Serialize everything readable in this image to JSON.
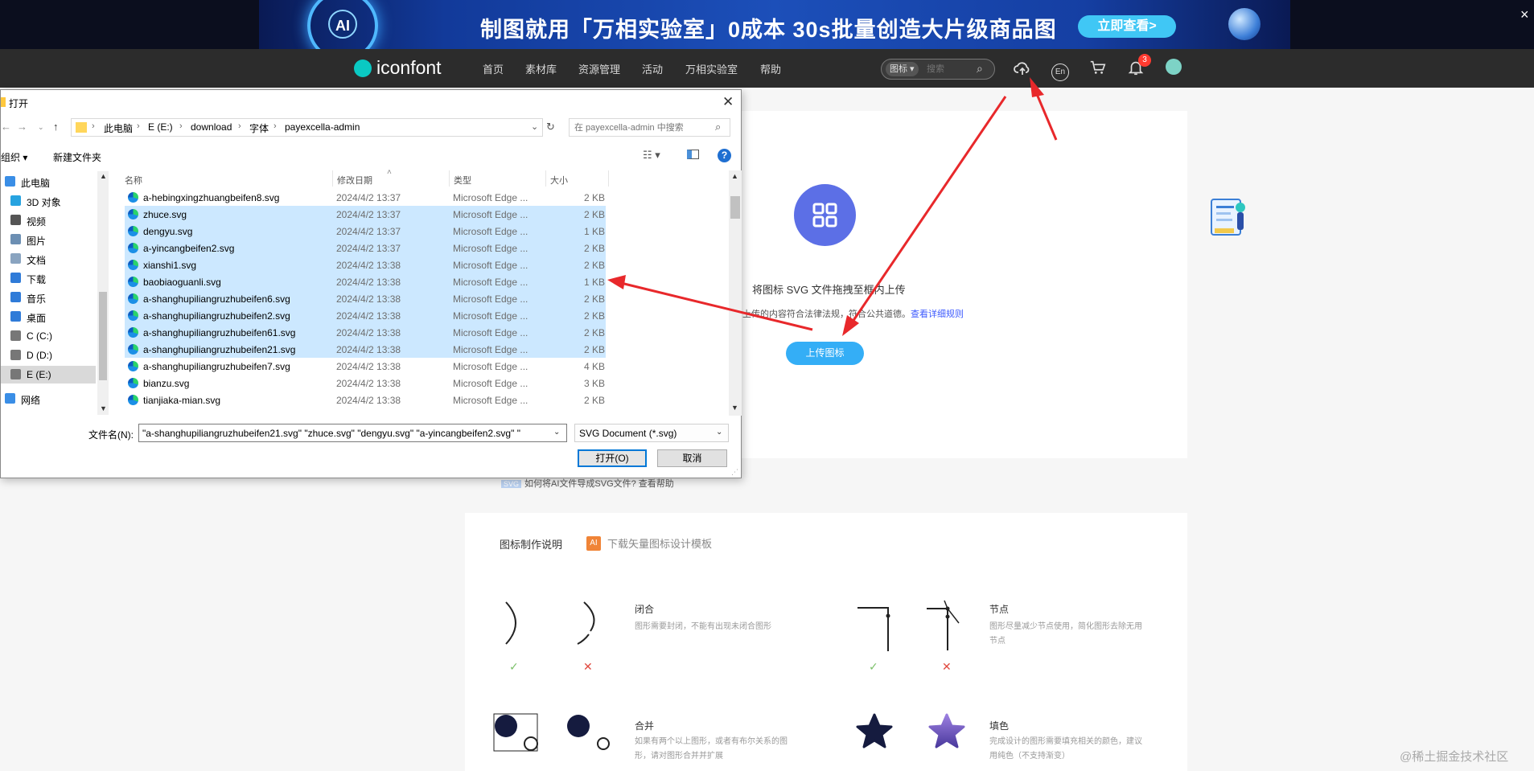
{
  "banner": {
    "ai_badge": "AI",
    "headline": "制图就用「万相实验室」0成本 30s批量创造大片级商品图",
    "cta": "立即查看>",
    "close": "×"
  },
  "nav": {
    "logo": "iconfont",
    "items": [
      "首页",
      "素材库",
      "资源管理",
      "活动",
      "万相实验室",
      "帮助"
    ],
    "search_type": "图标",
    "search_placeholder": "搜索",
    "lang_icon_text": "En",
    "notification_count": "3"
  },
  "upload": {
    "hint": "将图标 SVG 文件拖拽至框内上传",
    "legal": "上传的内容符合法律法规，符合公共道德。",
    "legal_link": "查看详细规则",
    "button": "上传图标",
    "ai_help_tag": "SVG",
    "ai_help": "如何将AI文件导成SVG文件? 查看帮助"
  },
  "guide": {
    "title": "图标制作说明",
    "template_icon": "AI",
    "template_link": "下载矢量图标设计模板",
    "rules": [
      {
        "title": "闭合",
        "desc": "图形需要封闭，不能有出现未闭合图形"
      },
      {
        "title": "节点",
        "desc": "图形尽量减少节点使用，简化图形去除无用节点"
      },
      {
        "title": "合并",
        "desc": "如果有两个以上图形，或者有布尔关系的图形，请对图形合并并扩展"
      },
      {
        "title": "填色",
        "desc": "完成设计的图形需要填充相关的颜色，建议用纯色（不支持渐变）"
      }
    ],
    "ok_mark": "✓",
    "bad_mark": "✕"
  },
  "watermark": "@稀土掘金技术社区",
  "dialog": {
    "title": "打开",
    "close": "✕",
    "path": [
      "此电脑",
      "E (E:)",
      "download",
      "字体",
      "payexcella-admin"
    ],
    "search_placeholder": "在 payexcella-admin 中搜索",
    "organize": "组织 ▾",
    "new_folder": "新建文件夹",
    "help": "?",
    "tree": [
      {
        "label": "此电脑",
        "color": "#3a8ee6"
      },
      {
        "label": "3D 对象",
        "color": "#27a3e0"
      },
      {
        "label": "视频",
        "color": "#555555"
      },
      {
        "label": "图片",
        "color": "#6c8fb3"
      },
      {
        "label": "文档",
        "color": "#8aa4c0"
      },
      {
        "label": "下载",
        "color": "#2f7bd8"
      },
      {
        "label": "音乐",
        "color": "#2f7bd8"
      },
      {
        "label": "桌面",
        "color": "#2f7bd8"
      },
      {
        "label": "C (C:)",
        "color": "#777777"
      },
      {
        "label": "D (D:)",
        "color": "#777777"
      },
      {
        "label": "E (E:)",
        "color": "#777777"
      },
      {
        "label": "网络",
        "color": "#3a8ee6"
      }
    ],
    "columns": {
      "name": "名称",
      "date": "修改日期",
      "type": "类型",
      "size": "大小"
    },
    "files": [
      {
        "name": "a-hebingxingzhuangbeifen8.svg",
        "date": "2024/4/2 13:37",
        "type": "Microsoft Edge ...",
        "size": "2 KB",
        "selected": false
      },
      {
        "name": "zhuce.svg",
        "date": "2024/4/2 13:37",
        "type": "Microsoft Edge ...",
        "size": "2 KB",
        "selected": true
      },
      {
        "name": "dengyu.svg",
        "date": "2024/4/2 13:37",
        "type": "Microsoft Edge ...",
        "size": "1 KB",
        "selected": true
      },
      {
        "name": "a-yincangbeifen2.svg",
        "date": "2024/4/2 13:37",
        "type": "Microsoft Edge ...",
        "size": "2 KB",
        "selected": true
      },
      {
        "name": "xianshi1.svg",
        "date": "2024/4/2 13:38",
        "type": "Microsoft Edge ...",
        "size": "2 KB",
        "selected": true
      },
      {
        "name": "baobiaoguanli.svg",
        "date": "2024/4/2 13:38",
        "type": "Microsoft Edge ...",
        "size": "1 KB",
        "selected": true
      },
      {
        "name": "a-shanghupiliangruzhubeifen6.svg",
        "date": "2024/4/2 13:38",
        "type": "Microsoft Edge ...",
        "size": "2 KB",
        "selected": true
      },
      {
        "name": "a-shanghupiliangruzhubeifen2.svg",
        "date": "2024/4/2 13:38",
        "type": "Microsoft Edge ...",
        "size": "2 KB",
        "selected": true
      },
      {
        "name": "a-shanghupiliangruzhubeifen61.svg",
        "date": "2024/4/2 13:38",
        "type": "Microsoft Edge ...",
        "size": "2 KB",
        "selected": true
      },
      {
        "name": "a-shanghupiliangruzhubeifen21.svg",
        "date": "2024/4/2 13:38",
        "type": "Microsoft Edge ...",
        "size": "2 KB",
        "selected": true
      },
      {
        "name": "a-shanghupiliangruzhubeifen7.svg",
        "date": "2024/4/2 13:38",
        "type": "Microsoft Edge ...",
        "size": "4 KB",
        "selected": false
      },
      {
        "name": "bianzu.svg",
        "date": "2024/4/2 13:38",
        "type": "Microsoft Edge ...",
        "size": "3 KB",
        "selected": false
      },
      {
        "name": "tianjiaka-mian.svg",
        "date": "2024/4/2 13:38",
        "type": "Microsoft Edge ...",
        "size": "2 KB",
        "selected": false
      }
    ],
    "filename_label": "文件名(N):",
    "filename_value": "\"a-shanghupiliangruzhubeifen21.svg\" \"zhuce.svg\" \"dengyu.svg\" \"a-yincangbeifen2.svg\" \"",
    "filetype": "SVG Document (*.svg)",
    "open": "打开(O)",
    "cancel": "取消"
  },
  "colors": {
    "accent_upload": "#34aef6",
    "upload_icon": "#5c6fe6",
    "selection": "#cce8ff",
    "annotation_arrow": "#e8282b"
  }
}
